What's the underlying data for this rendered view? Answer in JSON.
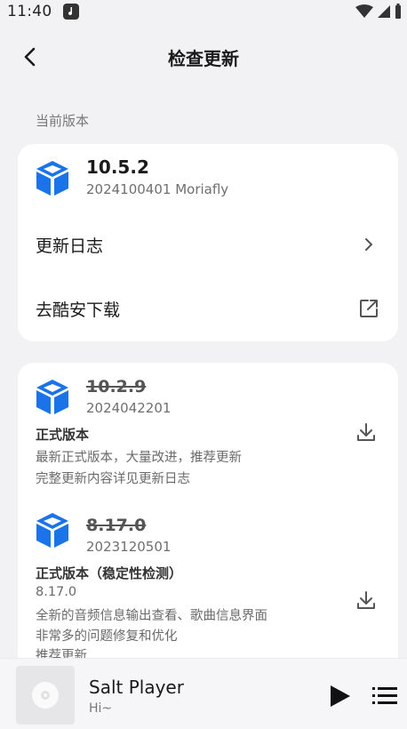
{
  "status_bar": {
    "time": "11:40",
    "icons": [
      "music-app-icon",
      "wifi-icon",
      "cellular-signal-icon",
      "battery-icon"
    ]
  },
  "app_bar": {
    "title": "检查更新",
    "back_icon": "chevron-left-icon"
  },
  "current_section": {
    "label": "当前版本",
    "version": "10.5.2",
    "build": "2024100401 Moriafly",
    "rows": [
      {
        "label": "更新日志",
        "icon": "chevron-right-icon"
      },
      {
        "label": "去酷安下载",
        "icon": "external-link-icon"
      }
    ]
  },
  "history": [
    {
      "version": "10.2.9",
      "build": "2024042201",
      "type": "正式版本",
      "lines": [
        "最新正式版本，大量改进，推荐更新",
        "完整更新内容详见更新日志"
      ]
    },
    {
      "version": "8.17.0",
      "build": "2023120501",
      "type": "正式版本（稳定性检测）",
      "lines": [
        "8.17.0",
        "全新的音频信息输出查看、歌曲信息界面",
        "非常多的问题修复和优化",
        "推荐更新"
      ]
    }
  ],
  "player": {
    "title": "Salt Player",
    "subtitle": "Hi~"
  },
  "colors": {
    "brand_blue": "#1a73e8",
    "background": "#f2f2f4",
    "card": "#ffffff"
  }
}
